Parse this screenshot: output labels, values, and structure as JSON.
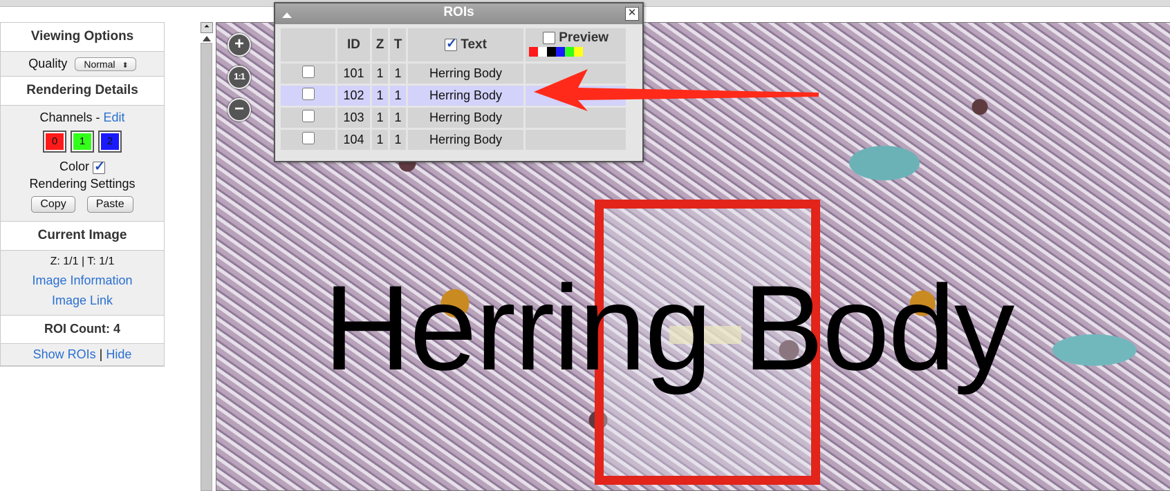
{
  "viewing_options": {
    "title": "Viewing Options",
    "quality_label": "Quality",
    "quality_value": "Normal"
  },
  "rendering_details": {
    "title": "Rendering Details",
    "channels_label": "Channels -",
    "edit_link": "Edit",
    "channels": [
      {
        "label": "0",
        "color": "#ff1a1a"
      },
      {
        "label": "1",
        "color": "#33ff1a"
      },
      {
        "label": "2",
        "color": "#1a1aff"
      }
    ],
    "color_label": "Color",
    "color_checked": true,
    "rendering_settings_label": "Rendering Settings",
    "copy_label": "Copy",
    "paste_label": "Paste"
  },
  "current_image": {
    "title": "Current Image",
    "z_t": "Z: 1/1 | T: 1/1",
    "info_link": "Image Information",
    "image_link": "Image Link"
  },
  "roi_count": {
    "title": "ROI Count: 4",
    "show": "Show ROIs",
    "separator": "|",
    "hide": "Hide"
  },
  "zoom_controls": {
    "zoom_in": "+",
    "one_to_one": "1:1",
    "zoom_out": "−"
  },
  "roi_window": {
    "title": "ROIs",
    "headers": {
      "id": "ID",
      "z": "Z",
      "t": "T",
      "text": "Text",
      "preview": "Preview"
    },
    "text_checked": true,
    "preview_checked": false,
    "preview_colors": [
      "#ff1a1a",
      "#ffffff",
      "#000000",
      "#1a1aff",
      "#33ff1a",
      "#ffff1a"
    ],
    "rows": [
      {
        "id": "101",
        "z": "1",
        "t": "1",
        "text": "Herring Body",
        "selected": false
      },
      {
        "id": "102",
        "z": "1",
        "t": "1",
        "text": "Herring Body",
        "selected": true
      },
      {
        "id": "103",
        "z": "1",
        "t": "1",
        "text": "Herring Body",
        "selected": false
      },
      {
        "id": "104",
        "z": "1",
        "t": "1",
        "text": "Herring Body",
        "selected": false
      }
    ]
  },
  "image_overlay": {
    "text": "Herring Body",
    "roi_color": "#e2241a",
    "arrow_color": "#ff2a1a"
  }
}
